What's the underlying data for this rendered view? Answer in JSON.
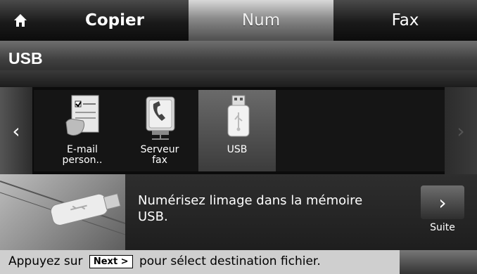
{
  "tabs": {
    "home_icon": "home-icon",
    "copier": "Copier",
    "num": "Num",
    "fax": "Fax",
    "active": "num"
  },
  "title": "USB",
  "carousel": {
    "items": [
      {
        "label_line1": "E-mail",
        "label_line2": "person..",
        "icon": "email-form-icon"
      },
      {
        "label_line1": "Serveur",
        "label_line2": "fax",
        "icon": "fax-server-icon"
      },
      {
        "label_line1": "USB",
        "label_line2": "",
        "icon": "usb-drive-icon",
        "selected": true
      }
    ]
  },
  "message": {
    "line1": "Numérisez limage dans la mémoire",
    "line2": "USB."
  },
  "suite_button": {
    "label": "Suite"
  },
  "status": {
    "prefix": "Appuyez sur",
    "key": "Next >",
    "suffix": "pour sélect destination fichier."
  }
}
